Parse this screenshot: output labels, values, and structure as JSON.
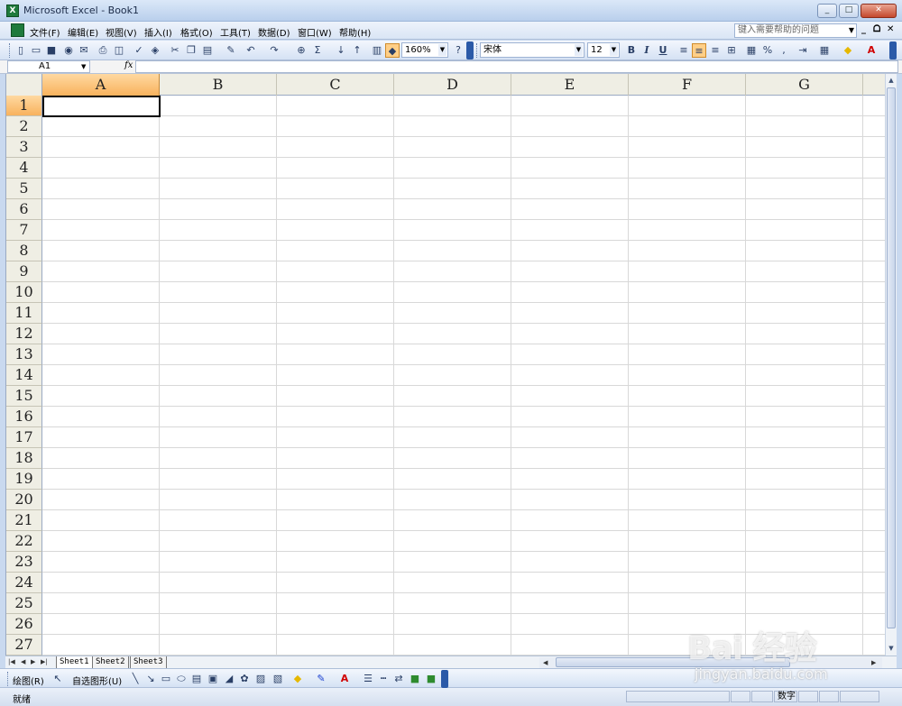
{
  "window": {
    "title": "Microsoft Excel - Book1",
    "controls": {
      "minimize": "_",
      "maximize": "□",
      "close": "✕"
    }
  },
  "menubar": {
    "items": [
      "文件(F)",
      "编辑(E)",
      "视图(V)",
      "插入(I)",
      "格式(O)",
      "工具(T)",
      "数据(D)",
      "窗口(W)",
      "帮助(H)"
    ],
    "help_placeholder": "键入需要帮助的问题",
    "doc_controls": [
      "_",
      "ᗝ",
      "✕"
    ]
  },
  "toolbar": {
    "zoom": "160%",
    "font_name": "宋体",
    "font_size": "12",
    "bold": "B",
    "italic": "I",
    "underline": "U",
    "percent": "%",
    "sum": "Σ"
  },
  "formulabar": {
    "name_box": "A1",
    "fx": "fx",
    "value": ""
  },
  "grid": {
    "columns": [
      "A",
      "B",
      "C",
      "D",
      "E",
      "F",
      "G"
    ],
    "rows": [
      "1",
      "2",
      "3",
      "4",
      "5",
      "6",
      "7",
      "8",
      "9",
      "10",
      "11",
      "12",
      "13",
      "14",
      "15",
      "16",
      "17",
      "18",
      "19",
      "20",
      "21",
      "22",
      "23",
      "24",
      "25",
      "26",
      "27"
    ],
    "active_cell": "A1"
  },
  "sheets": {
    "tabs": [
      "Sheet1",
      "Sheet2",
      "Sheet3"
    ],
    "active": "Sheet1"
  },
  "drawbar": {
    "draw_label": "绘图(R)",
    "autoshapes_label": "自选图形(U)"
  },
  "statusbar": {
    "status": "就绪",
    "mode": "数字"
  },
  "watermark": {
    "logo": "Bai 经验",
    "url": "jingyan.baidu.com"
  },
  "colors": {
    "selected_header": "#f8b25d",
    "header_bg": "#efeee4",
    "title_bar": "#b9cfec",
    "close_button": "#c4482d"
  }
}
